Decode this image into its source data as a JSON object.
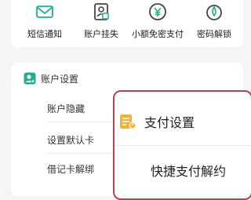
{
  "quick_actions": [
    {
      "label": "短信通知",
      "icon": "message-envelope-icon"
    },
    {
      "label": "账户挂失",
      "icon": "account-lock-icon"
    },
    {
      "label": "小额免密支付",
      "icon": "yen-coin-icon"
    },
    {
      "label": "密码解锁",
      "icon": "unlock-drop-icon"
    }
  ],
  "account_settings": {
    "title": "账户设置",
    "items": [
      "账户隐藏",
      "设置默认卡",
      "借记卡解绑"
    ]
  },
  "popup": {
    "title": "支付设置",
    "item": "快捷支付解约"
  },
  "colors": {
    "accent_green": "#1fae8e",
    "highlight_border": "#c43a54",
    "popup_icon": "#f2b233"
  }
}
